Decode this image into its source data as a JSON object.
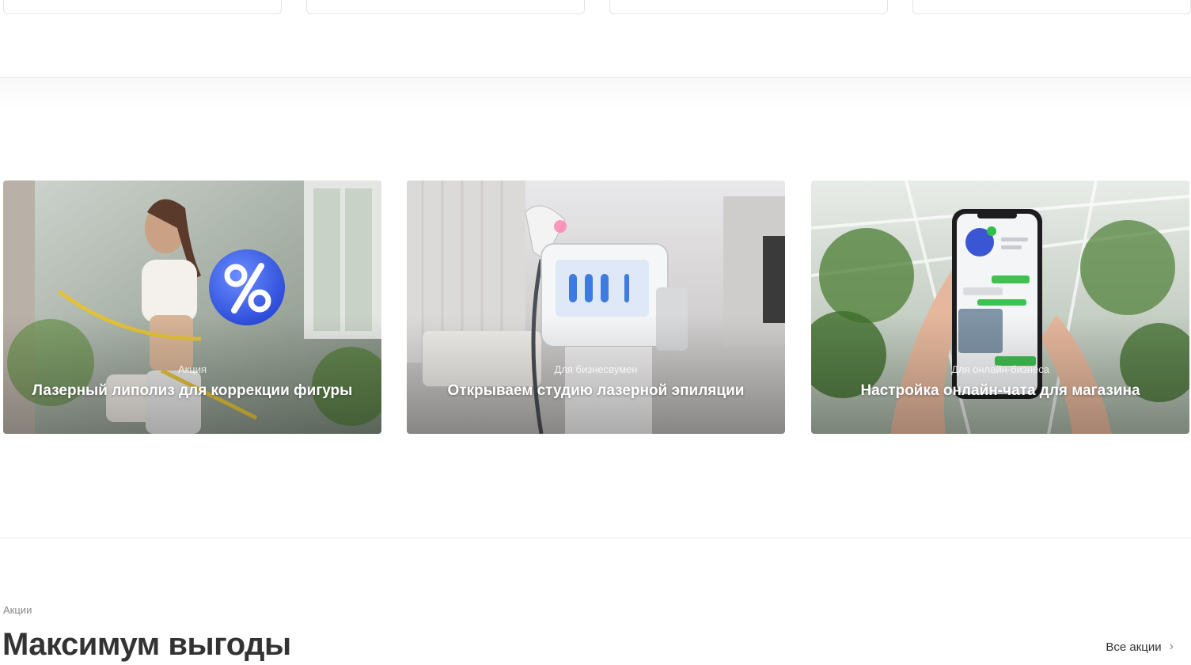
{
  "banners": [
    {
      "tag": "Акция",
      "title": "Лазерный липолиз для коррекции фигуры"
    },
    {
      "tag": "Для бизнесвумен",
      "title": "Открываем студию лазерной эпиляции"
    },
    {
      "tag": "Для онлайн-бизнеса",
      "title": "Настройка онлайн-чата для магазина"
    }
  ],
  "section": {
    "eyebrow": "Акции",
    "title": "Максимум выгоды",
    "all_link": "Все акции"
  }
}
